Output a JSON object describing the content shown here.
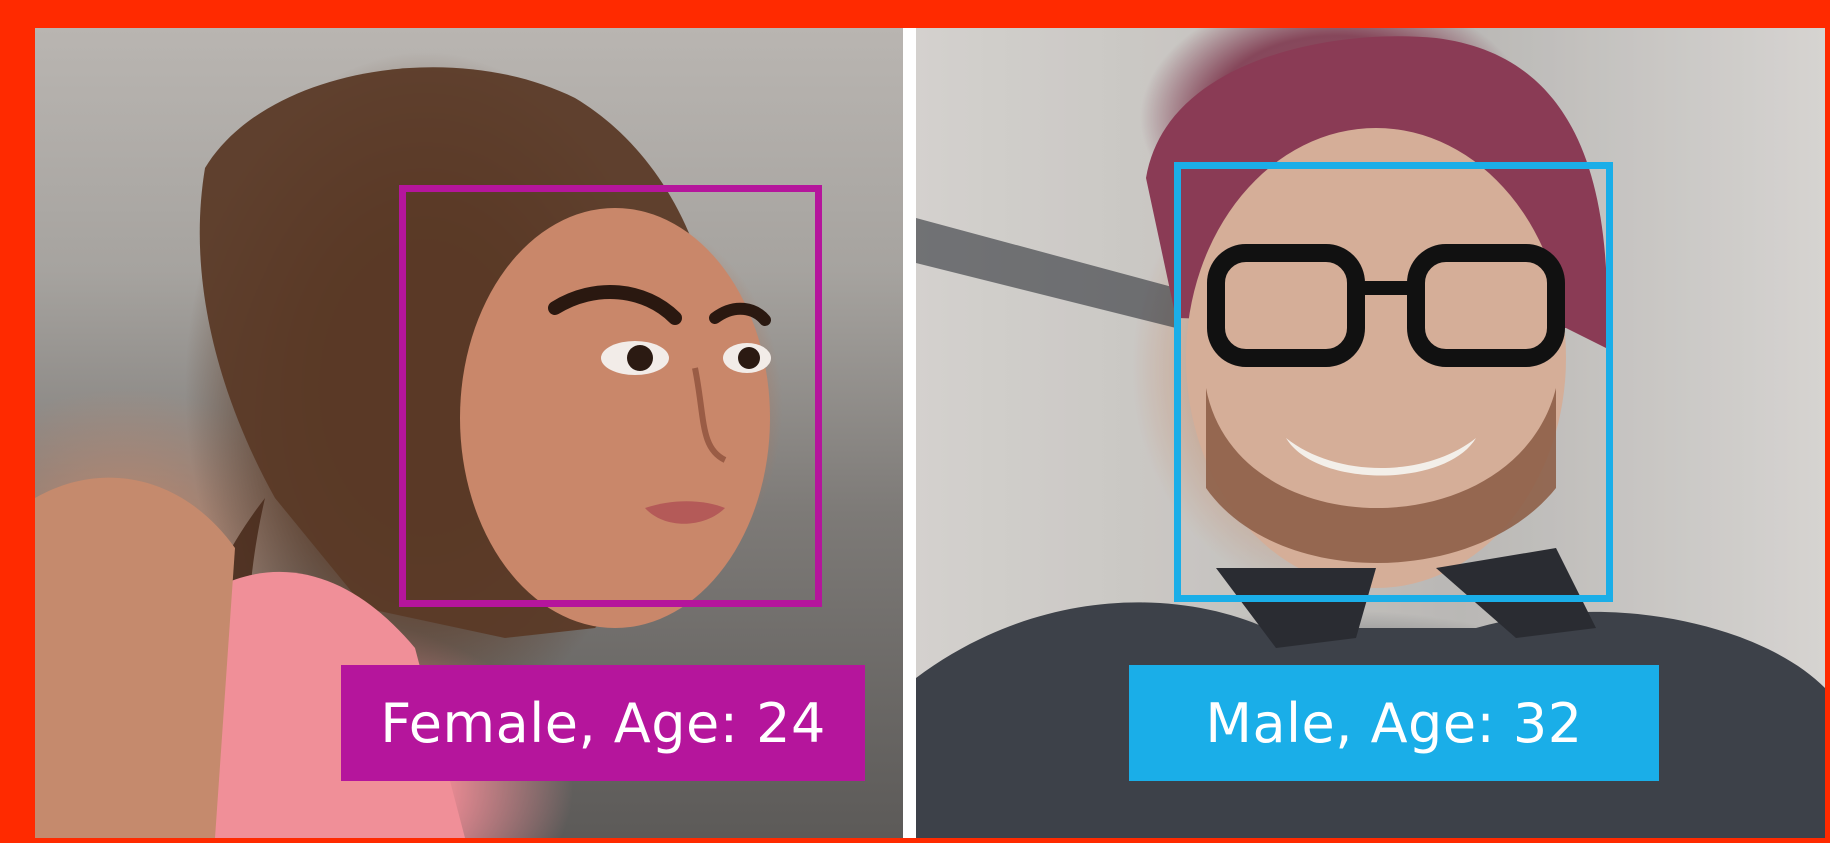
{
  "frame": {
    "border_color": "#ff2a00",
    "divider_color": "#ffffff"
  },
  "detections": [
    {
      "label": "Female, Age: 24",
      "gender": "Female",
      "age": 24,
      "color": "#b5159c"
    },
    {
      "label": "Male, Age: 32",
      "gender": "Male",
      "age": 32,
      "color": "#1aaee8"
    }
  ]
}
